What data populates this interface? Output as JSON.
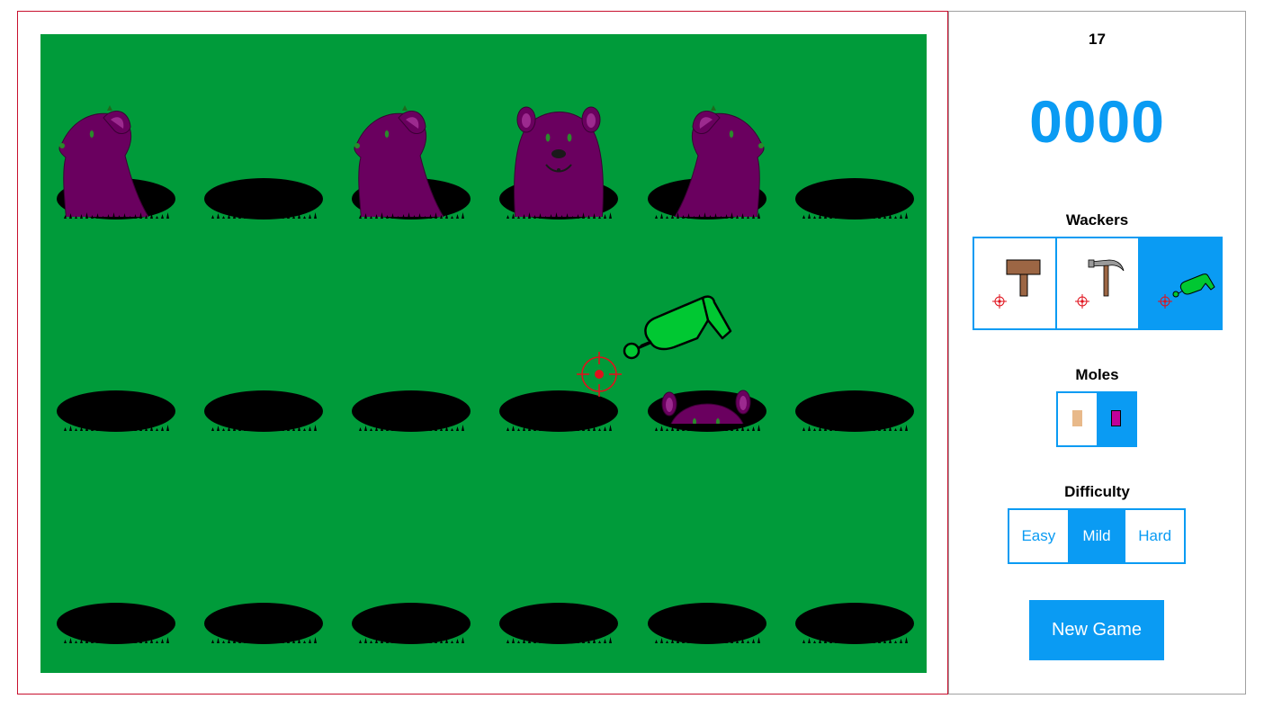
{
  "game": {
    "field_color": "#009b3a",
    "grid": {
      "rows": 3,
      "cols": 6
    },
    "holes": [
      {
        "row": 0,
        "col": 0,
        "mole": "side-left"
      },
      {
        "row": 0,
        "col": 1,
        "mole": "none"
      },
      {
        "row": 0,
        "col": 2,
        "mole": "side-left"
      },
      {
        "row": 0,
        "col": 3,
        "mole": "front"
      },
      {
        "row": 0,
        "col": 4,
        "mole": "side-right"
      },
      {
        "row": 0,
        "col": 5,
        "mole": "none"
      },
      {
        "row": 1,
        "col": 0,
        "mole": "none"
      },
      {
        "row": 1,
        "col": 1,
        "mole": "none"
      },
      {
        "row": 1,
        "col": 2,
        "mole": "none"
      },
      {
        "row": 1,
        "col": 3,
        "mole": "none"
      },
      {
        "row": 1,
        "col": 4,
        "mole": "peeking"
      },
      {
        "row": 1,
        "col": 5,
        "mole": "none"
      },
      {
        "row": 2,
        "col": 0,
        "mole": "none"
      },
      {
        "row": 2,
        "col": 1,
        "mole": "none"
      },
      {
        "row": 2,
        "col": 2,
        "mole": "none"
      },
      {
        "row": 2,
        "col": 3,
        "mole": "none"
      },
      {
        "row": 2,
        "col": 4,
        "mole": "none"
      },
      {
        "row": 2,
        "col": 5,
        "mole": "none"
      }
    ],
    "mole_color": "#6a005f",
    "cursor": {
      "wacker": "water-cannon-icon",
      "crosshair": "crosshair-icon"
    }
  },
  "panel": {
    "timer": "17",
    "score": "0000",
    "wackers_title": "Wackers",
    "wackers": [
      {
        "icon": "mallet-icon",
        "selected": false
      },
      {
        "icon": "hammer-icon",
        "selected": false
      },
      {
        "icon": "water-cannon-icon",
        "selected": true
      }
    ],
    "moles_title": "Moles",
    "moles": [
      {
        "color": "#e8b98a",
        "selected": false
      },
      {
        "color": "#c0009a",
        "selected": true
      }
    ],
    "difficulty_title": "Difficulty",
    "difficulty": [
      {
        "label": "Easy",
        "selected": false
      },
      {
        "label": "Mild",
        "selected": true
      },
      {
        "label": "Hard",
        "selected": false
      }
    ],
    "new_game_label": "New Game"
  },
  "colors": {
    "accent": "#0a9bf3",
    "frame": "#c8102e"
  }
}
